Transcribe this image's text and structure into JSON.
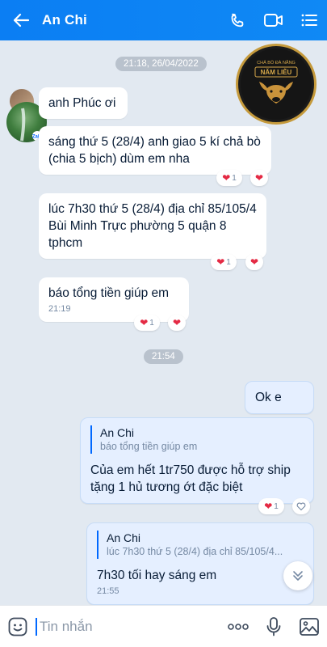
{
  "header": {
    "title": "An Chi",
    "icons": [
      "back-arrow-icon",
      "phone-icon",
      "video-call-icon",
      "menu-list-icon"
    ]
  },
  "shop_logo": {
    "small_text": "CHẢ BÒ ĐÀ NẴNG",
    "name": "NĂM LIỄU"
  },
  "messages": {
    "time_divider_1": "21:18, 26/04/2022",
    "msg1": "anh Phúc ơi",
    "msg2": "sáng thứ 5 (28/4) anh giao 5 kí chả bò (chia 5 bịch) dùm em nha",
    "msg2_react_count": "1",
    "msg3": "lúc 7h30 thứ 5 (28/4) địa chỉ 85/105/4 Bùi Minh Trực phường 5 quận 8 tphcm",
    "msg3_react_count": "1",
    "msg4": "báo tổng tiền giúp em",
    "msg4_time": "21:19",
    "msg4_react_count": "1",
    "time_divider_2": "21:54",
    "reply1": "Ok e",
    "reply2_quote_author": "An Chi",
    "reply2_quote_text": "báo tổng tiền giúp em",
    "reply2_text": "Của em hết 1tr750 được hỗ trợ ship tặng 1 hủ tương ớt đặc biệt",
    "reply2_react_count": "1",
    "reply3_quote_author": "An Chi",
    "reply3_quote_text": "lúc 7h30 thứ 5 (28/4) địa chỉ 85/105/4...",
    "reply3_text": "7h30 tối hay sáng em",
    "reply3_time": "21:55"
  },
  "input": {
    "placeholder": "Tin nhắn",
    "icons": [
      "sticker-icon",
      "more-icon",
      "microphone-icon",
      "image-icon"
    ]
  },
  "colors": {
    "header": "#0b7ef3",
    "accent": "#0068ff",
    "heart": "#e42a44",
    "chat_bg": "#e2e9f1",
    "my_bubble": "#e5efff"
  }
}
